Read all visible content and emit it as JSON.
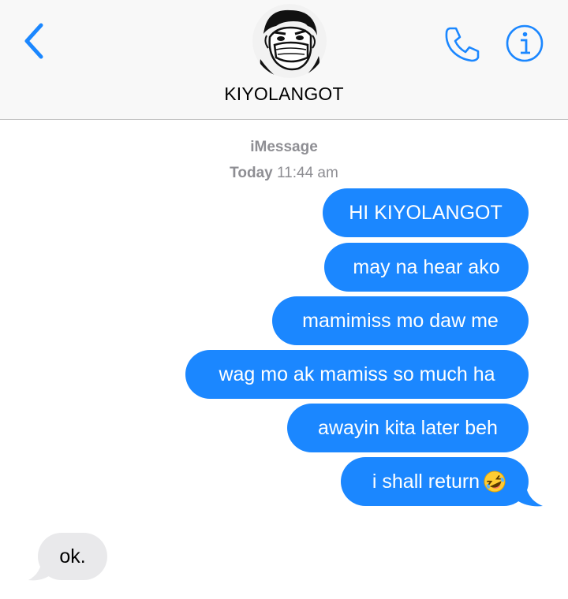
{
  "header": {
    "contact_name": "KIYOLANGOT",
    "icons": {
      "back": "chevron-left-icon",
      "phone": "phone-icon",
      "info": "info-icon"
    },
    "accent_color": "#1b87ff"
  },
  "thread": {
    "service": "iMessage",
    "day": "Today",
    "time": "11:44 am"
  },
  "messages": [
    {
      "direction": "outgoing",
      "text": "HI KIYOLANGOT"
    },
    {
      "direction": "outgoing",
      "text": "may na hear ako"
    },
    {
      "direction": "outgoing",
      "text": "mamimiss mo daw me"
    },
    {
      "direction": "outgoing",
      "text": "wag mo ak mamiss so much ha"
    },
    {
      "direction": "outgoing",
      "text": "awayin kita later beh"
    },
    {
      "direction": "outgoing",
      "text": "i shall return",
      "emoji": "rolling-on-the-floor-laughing-emoji"
    },
    {
      "direction": "incoming",
      "text": "ok."
    }
  ],
  "colors": {
    "outgoing_bubble": "#1b87ff",
    "incoming_bubble": "#e9e9eb",
    "meta_text": "#8e8e93"
  }
}
